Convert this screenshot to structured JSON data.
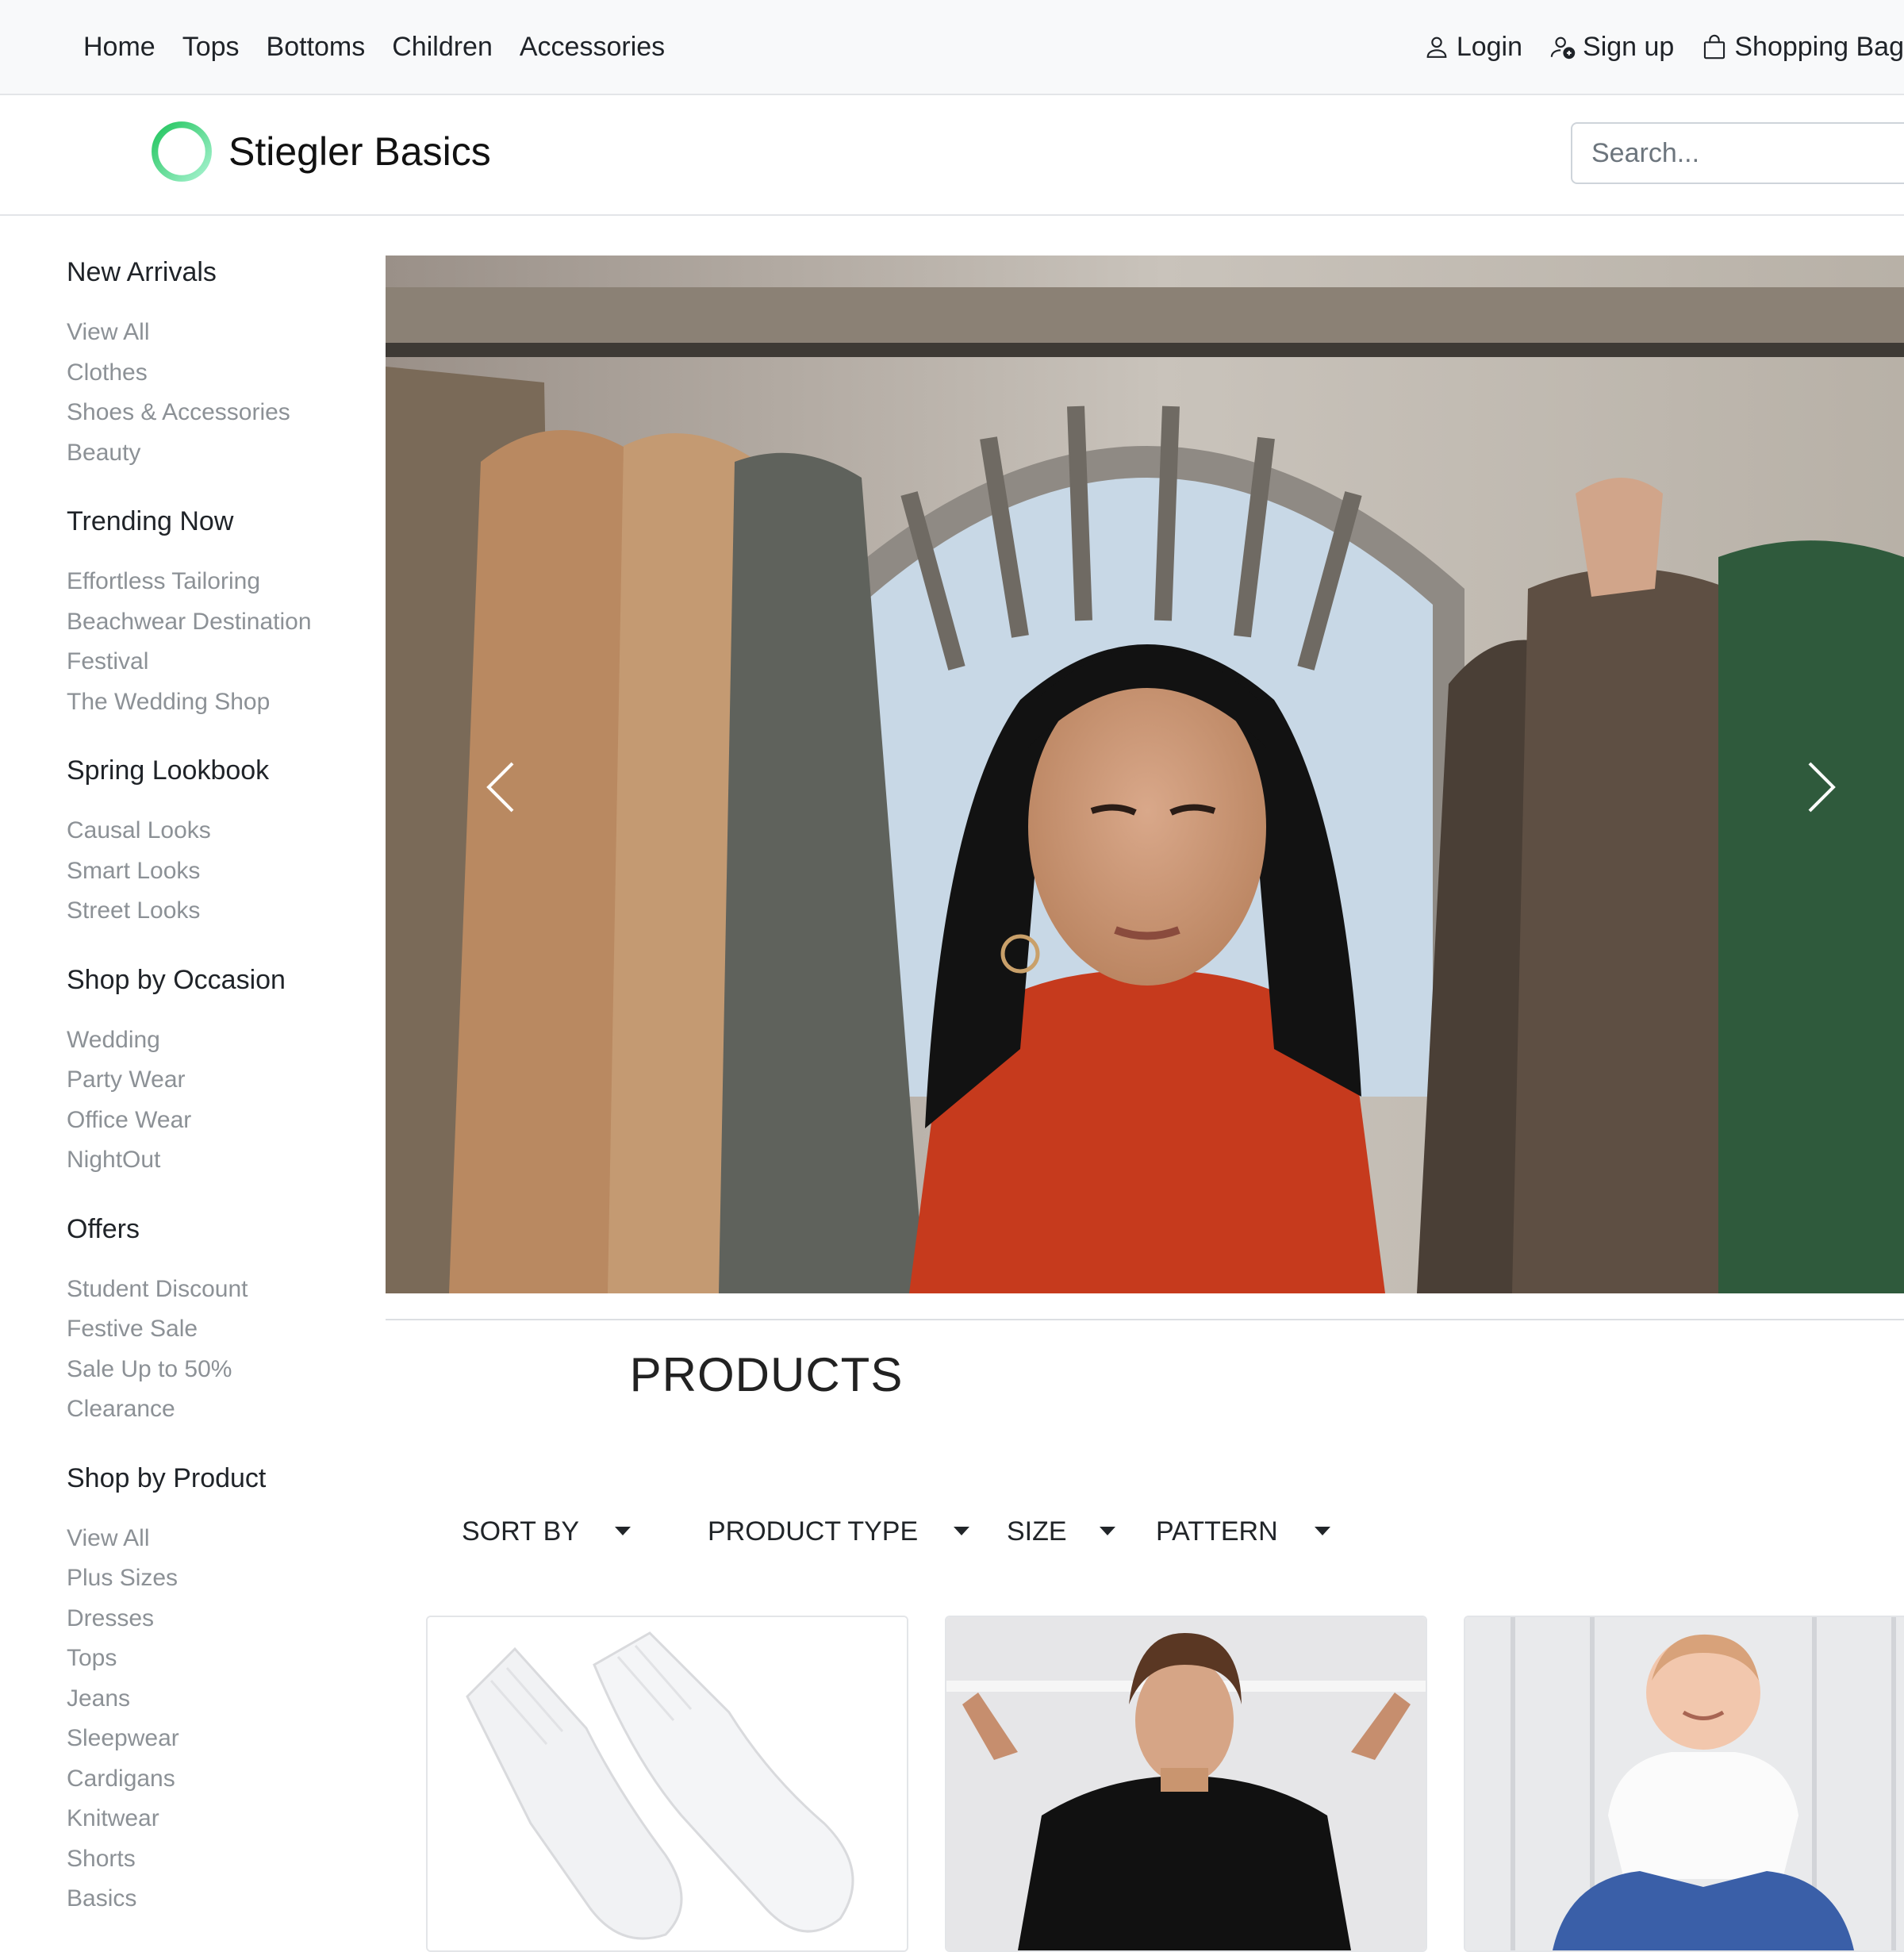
{
  "topnav": {
    "links": [
      "Home",
      "Tops",
      "Bottoms",
      "Children",
      "Accessories"
    ],
    "login": "Login",
    "signup": "Sign up",
    "bag": "Shopping Bag"
  },
  "brand": {
    "name": "Stiegler Basics",
    "logo_icon": "ring-logo-icon",
    "accent": "#3ddc6a"
  },
  "search": {
    "placeholder": "Search..."
  },
  "sidebar": [
    {
      "heading": "New Arrivals",
      "items": [
        "View All",
        "Clothes",
        "Shoes & Accessories",
        "Beauty"
      ]
    },
    {
      "heading": "Trending Now",
      "items": [
        "Effortless Tailoring",
        "Beachwear Destination",
        "Festival",
        "The Wedding Shop"
      ]
    },
    {
      "heading": "Spring Lookbook",
      "items": [
        "Causal Looks",
        "Smart Looks",
        "Street Looks"
      ]
    },
    {
      "heading": "Shop by Occasion",
      "items": [
        "Wedding",
        "Party Wear",
        "Office Wear",
        "NightOut"
      ]
    },
    {
      "heading": "Offers",
      "items": [
        "Student Discount",
        "Festive Sale",
        "Sale Up to 50%",
        "Clearance"
      ]
    },
    {
      "heading": "Shop by Product",
      "items": [
        "View All",
        "Plus Sizes",
        "Dresses",
        "Tops",
        "Jeans",
        "Sleepwear",
        "Cardigans",
        "Knitwear",
        "Shorts",
        "Basics"
      ]
    }
  ],
  "hero": {
    "prev_icon": "chevron-left-icon",
    "next_icon": "chevron-right-icon"
  },
  "products": {
    "title": "PRODUCTS",
    "filters": [
      "SORT BY",
      "PRODUCT TYPE",
      "SIZE",
      "PATTERN"
    ]
  }
}
